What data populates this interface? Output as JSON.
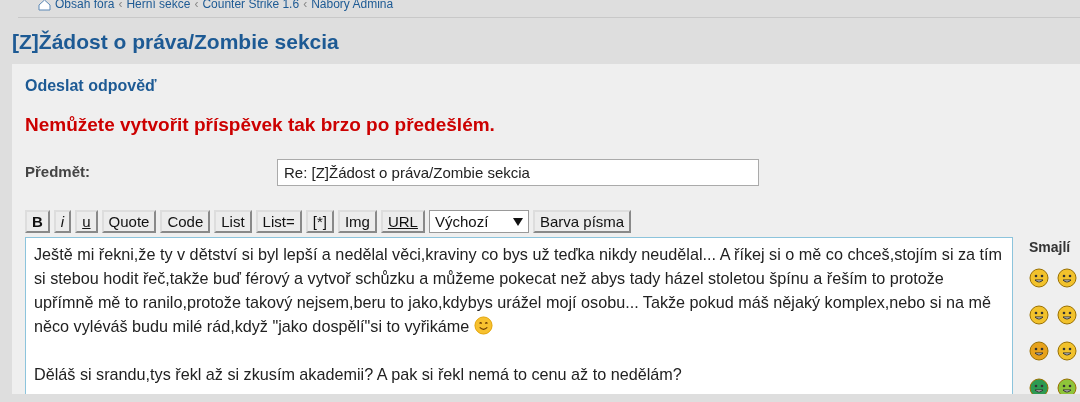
{
  "breadcrumb": [
    "Obsah fóra",
    "Herní sekce",
    "Counter Strike 1.6",
    "Nábory Admina"
  ],
  "breadcrumb_separator": "‹",
  "topic_title": "[Z]Žádost o práva/Zombie sekcia",
  "form": {
    "heading": "Odeslat odpověď",
    "error": "Nemůžete vytvořit příspěvek tak brzo po předešlém.",
    "subject_label": "Předmět:",
    "subject_value": "Re: [Z]Žádost o práva/Zombie sekcia",
    "toolbar": [
      {
        "label": "B",
        "kind": "bold"
      },
      {
        "label": "i",
        "kind": "italic"
      },
      {
        "label": "u",
        "kind": "underline"
      },
      {
        "label": "Quote",
        "kind": "plain"
      },
      {
        "label": "Code",
        "kind": "plain"
      },
      {
        "label": "List",
        "kind": "plain"
      },
      {
        "label": "List=",
        "kind": "plain"
      },
      {
        "label": "[*]",
        "kind": "plain"
      },
      {
        "label": "Img",
        "kind": "plain"
      },
      {
        "label": "URL",
        "kind": "underline"
      },
      {
        "label": "Výchozí",
        "kind": "select"
      },
      {
        "label": "Barva písma",
        "kind": "plain"
      }
    ],
    "message": [
      {
        "text": "Ještě mi řekni,že ty v dětství si byl lepší a nedělal věci,kraviny co bys už teďka nikdy neudělal... A říkej si o mě co chceš,stojím si za tím si stebou hodit řeč,takže buď férový a vytvoř schůzku a můžeme pokecat než abys tady házel stoletou špínu a řeším to protože upřímně mě to ranilo,protože takový nejsem,beru to jako,kdybys urážel mojí osobu... Takže pokud máš nějaký komplex,nebo si na mě něco vyléváš budu milé rád,když \"jako dospělí\"si to vyřikáme",
        "smiley": true
      },
      {
        "text": "Děláš si srandu,tys řekl až si zkusím akademii? A pak si řekl nemá to cenu až to nedělám?",
        "smiley": false
      }
    ],
    "smileys_heading": "Smajlí"
  }
}
